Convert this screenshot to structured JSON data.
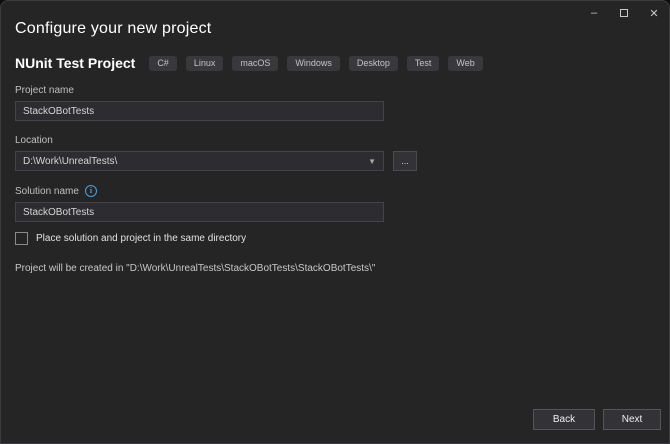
{
  "window": {
    "title": "Configure your new project",
    "controls": {
      "minimize_glyph": "–",
      "close_glyph": "✕"
    }
  },
  "template": {
    "name": "NUnit Test Project",
    "tags": [
      "C#",
      "Linux",
      "macOS",
      "Windows",
      "Desktop",
      "Test",
      "Web"
    ]
  },
  "form": {
    "project_name": {
      "label": "Project name",
      "value": "StackOBotTests"
    },
    "location": {
      "label": "Location",
      "value": "D:\\Work\\UnrealTests\\",
      "caret_glyph": "▼",
      "browse_label": "..."
    },
    "solution_name": {
      "label": "Solution name",
      "info_glyph": "i",
      "value": "StackOBotTests"
    },
    "same_directory_checkbox": {
      "label": "Place solution and project in the same directory",
      "checked": false
    },
    "summary": "Project will be created in \"D:\\Work\\UnrealTests\\StackOBotTests\\StackOBotTests\\\""
  },
  "footer": {
    "back_label": "Back",
    "next_label": "Next"
  },
  "colors": {
    "background": "#252526",
    "input_background": "#2d2d31",
    "border": "#43434a",
    "accent_info": "#4ba0e0",
    "button_background": "#333337",
    "title_text": "#ffffff"
  }
}
